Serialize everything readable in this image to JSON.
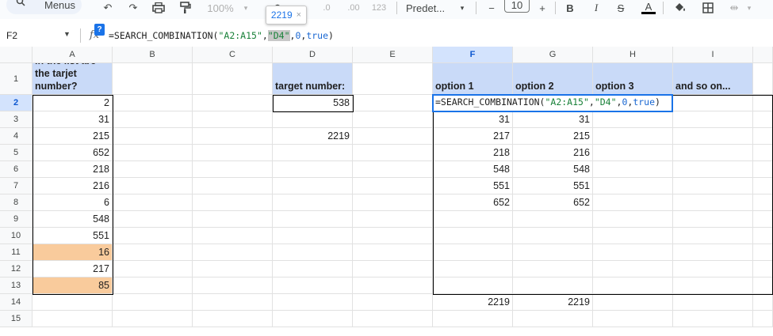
{
  "toolbar": {
    "menus_label": "Menus",
    "zoom": "100%",
    "font_name": "Predet...",
    "font_size": "10",
    "num_format": "123"
  },
  "tooltip": {
    "value": "2219",
    "close": "×"
  },
  "formula_bar": {
    "name_box": "F2",
    "fx": "fx",
    "help": "?",
    "f_prefix": "=SEARCH_COMBINATION(",
    "f_range": "\"A2:A15\"",
    "f_comma1": ",",
    "f_target": "\"D4\"",
    "f_comma2": ",",
    "f_zero": "0",
    "f_comma3": ",",
    "f_true": "true",
    "f_close": ")"
  },
  "columns": [
    "A",
    "B",
    "C",
    "D",
    "E",
    "F",
    "G",
    "H",
    "I"
  ],
  "rows": [
    "1",
    "2",
    "3",
    "4",
    "5",
    "6",
    "7",
    "8",
    "9",
    "10",
    "11",
    "12",
    "13",
    "14",
    "15"
  ],
  "cells": {
    "A1": "the sum of wich numbers in the list are the tarjet number?",
    "A2": "2",
    "A3": "31",
    "A4": "215",
    "A5": "652",
    "A6": "218",
    "A7": "216",
    "A8": "6",
    "A9": "548",
    "A10": "551",
    "A11": "16",
    "A12": "217",
    "A13": "85",
    "D1": "target number:",
    "D2": "538",
    "D4": "2219",
    "F1": "option 1",
    "G1": "option 2",
    "H1": "option 3",
    "I1": "and so on...",
    "F3": "31",
    "F4": "217",
    "F5": "218",
    "F6": "548",
    "F7": "551",
    "F8": "652",
    "G3": "31",
    "G4": "215",
    "G5": "216",
    "G6": "548",
    "G7": "551",
    "G8": "652",
    "F14": "2219",
    "G14": "2219"
  },
  "colors": {
    "header_fill": "#c9daf8",
    "highlight_fill": "#f9cb9c",
    "selection": "#1a73e8"
  }
}
